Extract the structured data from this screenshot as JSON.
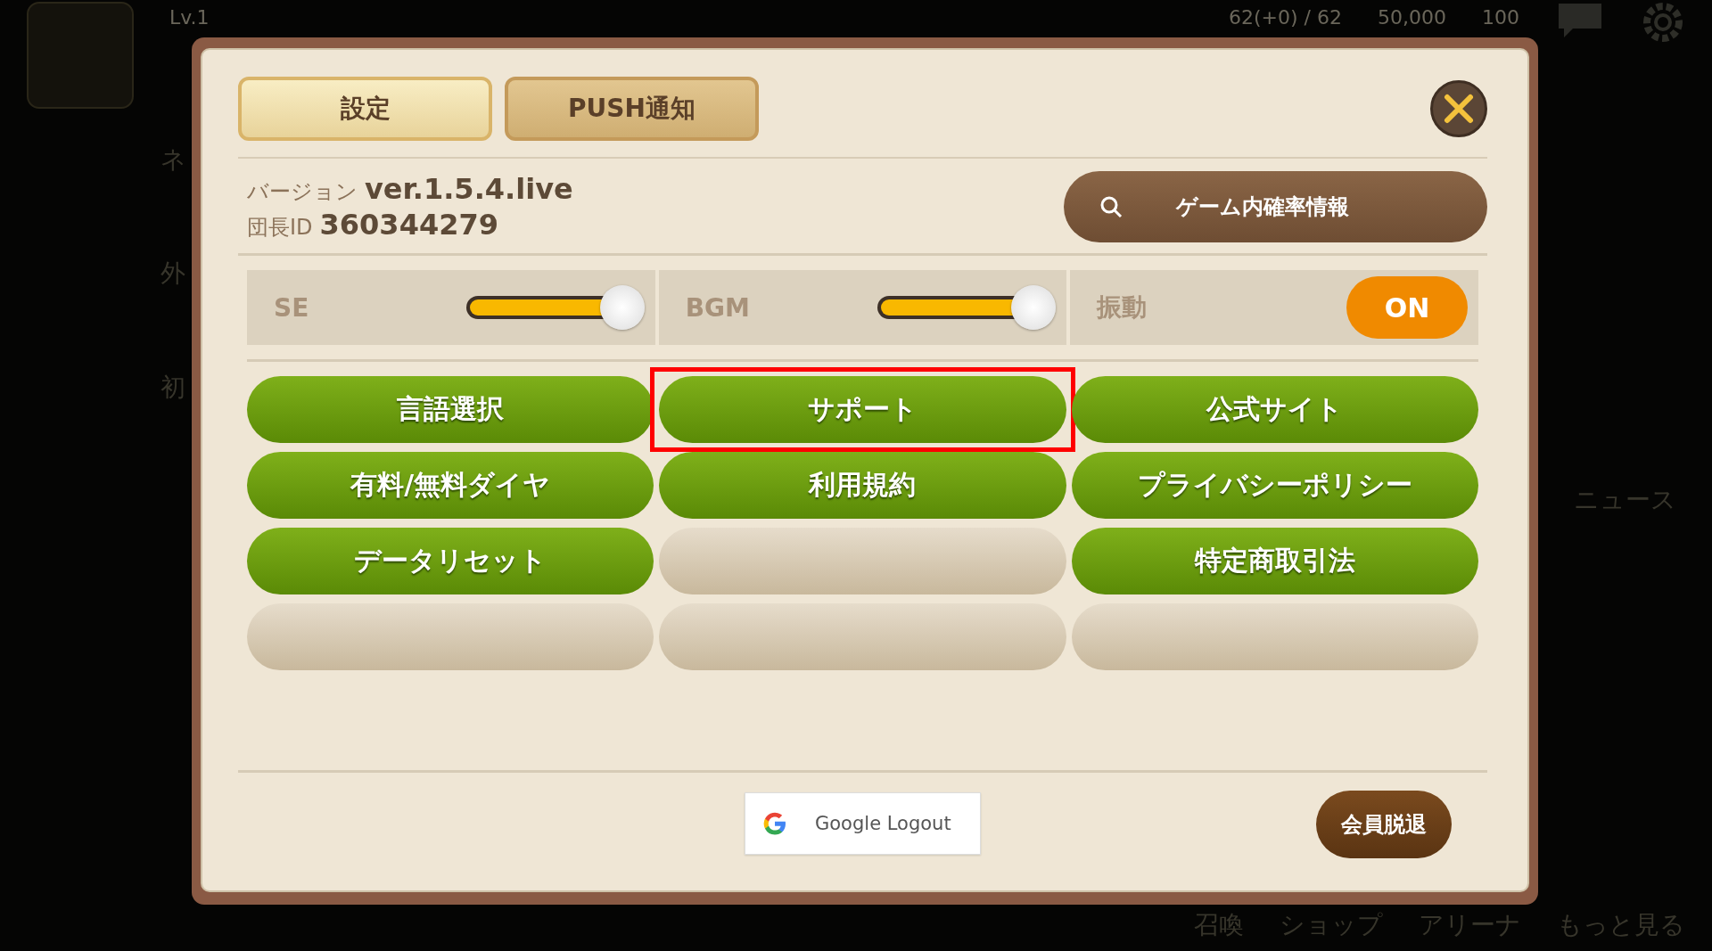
{
  "background": {
    "level_label": "Lv.1",
    "resources": [
      "62(+0) / 62",
      "50,000",
      "100"
    ],
    "left_items": [
      "ネ",
      "外",
      "初"
    ],
    "right_items": [
      "ニュース"
    ],
    "bottom_nav": [
      "召喚",
      "ショップ",
      "アリーナ",
      "もっと見る"
    ]
  },
  "dialog": {
    "tabs": [
      {
        "label": "設定",
        "selected": true
      },
      {
        "label": "PUSH通知",
        "selected": false
      }
    ],
    "version_label": "バージョン",
    "version": "ver.1.5.4.live",
    "id_label": "団長ID",
    "id": "360344279",
    "probability_button": "ゲーム内確率情報",
    "sound": [
      {
        "kind": "slider",
        "label": "SE",
        "level": 1
      },
      {
        "kind": "slider",
        "label": "BGM",
        "level": 1
      },
      {
        "kind": "toggle",
        "label": "振動",
        "on": true,
        "value": "ON"
      }
    ],
    "menu": [
      {
        "kind": "button",
        "label": "言語選択",
        "highlighted": false
      },
      {
        "kind": "button",
        "label": "サポート",
        "highlighted": true
      },
      {
        "kind": "button",
        "label": "公式サイト",
        "highlighted": false
      },
      {
        "kind": "button",
        "label": "有料/無料ダイヤ",
        "highlighted": false
      },
      {
        "kind": "button",
        "label": "利用規約",
        "highlighted": false
      },
      {
        "kind": "button",
        "label": "プライバシーポリシー",
        "highlighted": false
      },
      {
        "kind": "button",
        "label": "データリセット",
        "highlighted": false
      },
      {
        "kind": "empty",
        "highlighted": false
      },
      {
        "kind": "button",
        "label": "特定商取引法",
        "highlighted": false
      },
      {
        "kind": "empty",
        "highlighted": false
      },
      {
        "kind": "empty",
        "highlighted": false
      },
      {
        "kind": "empty",
        "highlighted": false
      }
    ],
    "google_logout": "Google Logout",
    "withdraw_button": "会員脱退"
  }
}
